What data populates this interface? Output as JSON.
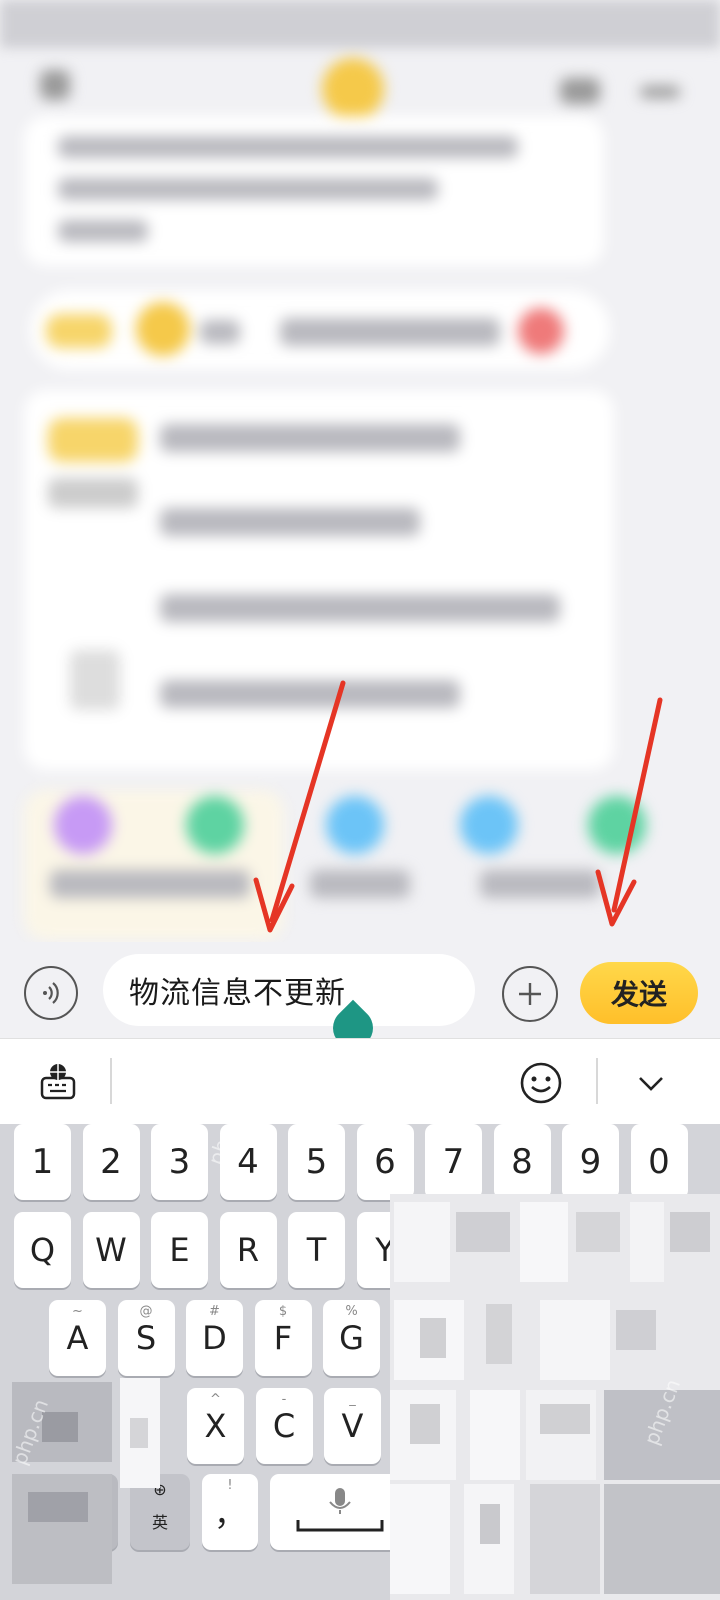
{
  "input": {
    "value": "物流信息不更新"
  },
  "actions": {
    "send_label": "发送"
  },
  "keyboard": {
    "number_row": [
      "1",
      "2",
      "3",
      "4",
      "5",
      "6",
      "7",
      "8",
      "9",
      "0"
    ],
    "row1": [
      "Q",
      "W",
      "E",
      "R",
      "T",
      "Y"
    ],
    "row2": [
      {
        "key": "A",
        "hint": "~"
      },
      {
        "key": "S",
        "hint": "@"
      },
      {
        "key": "D",
        "hint": "#"
      },
      {
        "key": "F",
        "hint": "$"
      },
      {
        "key": "G",
        "hint": "%"
      }
    ],
    "row3": [
      {
        "key": "X",
        "hint": "^"
      },
      {
        "key": "C",
        "hint": "-"
      },
      {
        "key": "V",
        "hint": "_"
      }
    ],
    "lang_key": "英",
    "comma_key": "，",
    "comma_hint": "!"
  },
  "icons": {
    "voice": "voice-wave-icon",
    "plus": "plus-icon",
    "keyboard_settings": "keyboard-globe-icon",
    "emoji": "smiley-icon",
    "collapse": "chevron-down-icon",
    "mic": "microphone-icon"
  },
  "colors": {
    "send_button": "#ffc93a",
    "cursor_handle": "#1e9684",
    "annotation_arrow": "#e53525"
  },
  "watermark": "php.cn"
}
